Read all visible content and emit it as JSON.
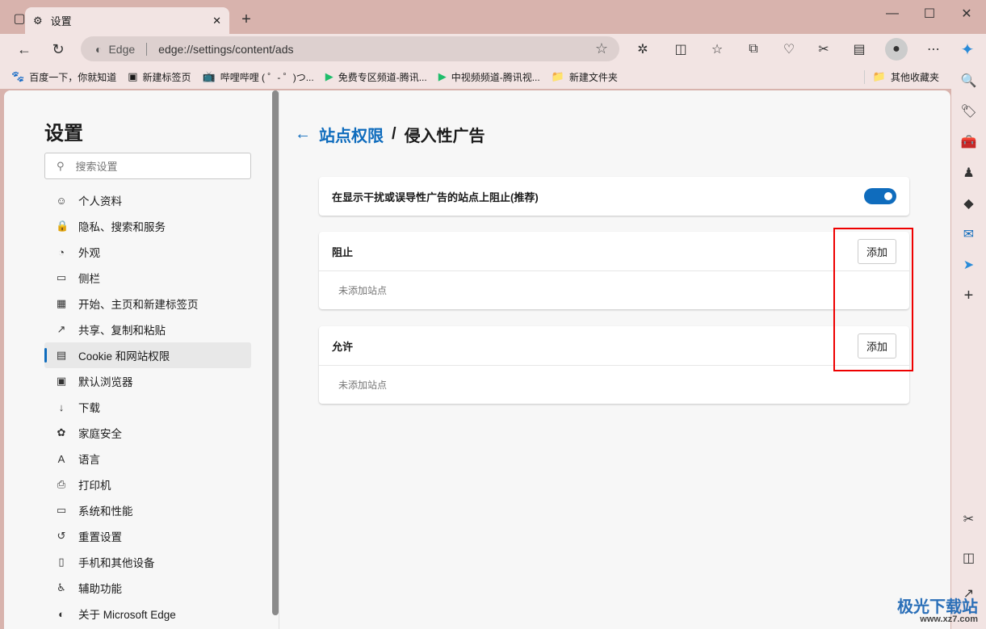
{
  "browser": {
    "tab_title": "设置",
    "address_label": "Edge",
    "url": "edge://settings/content/ads",
    "bookmarks": [
      {
        "label": "百度一下，你就知道",
        "icon": "paw-icon"
      },
      {
        "label": "新建标签页",
        "icon": "newtab-icon"
      },
      {
        "label": "哔哩哔哩 ( ゜- ゜)つ...",
        "icon": "bilibili-icon"
      },
      {
        "label": "免费专区频道-腾讯...",
        "icon": "tencent-video-icon"
      },
      {
        "label": "中视频频道-腾讯视...",
        "icon": "tencent-video-icon"
      },
      {
        "label": "新建文件夹",
        "icon": "folder-icon"
      }
    ],
    "other_bookmarks": "其他收藏夹"
  },
  "settings": {
    "title": "设置",
    "search_placeholder": "搜索设置",
    "nav": [
      {
        "label": "个人资料",
        "icon": "profile-icon"
      },
      {
        "label": "隐私、搜索和服务",
        "icon": "lock-icon"
      },
      {
        "label": "外观",
        "icon": "palette-icon"
      },
      {
        "label": "侧栏",
        "icon": "sidebar-icon"
      },
      {
        "label": "开始、主页和新建标签页",
        "icon": "home-icon"
      },
      {
        "label": "共享、复制和粘贴",
        "icon": "share-icon"
      },
      {
        "label": "Cookie 和网站权限",
        "icon": "cookie-icon",
        "active": true
      },
      {
        "label": "默认浏览器",
        "icon": "browser-icon"
      },
      {
        "label": "下载",
        "icon": "download-icon"
      },
      {
        "label": "家庭安全",
        "icon": "family-icon"
      },
      {
        "label": "语言",
        "icon": "language-icon"
      },
      {
        "label": "打印机",
        "icon": "printer-icon"
      },
      {
        "label": "系统和性能",
        "icon": "laptop-icon"
      },
      {
        "label": "重置设置",
        "icon": "reset-icon"
      },
      {
        "label": "手机和其他设备",
        "icon": "phone-icon"
      },
      {
        "label": "辅助功能",
        "icon": "accessibility-icon"
      },
      {
        "label": "关于 Microsoft Edge",
        "icon": "edge-icon"
      }
    ]
  },
  "page": {
    "breadcrumb_parent": "站点权限",
    "breadcrumb_sep": "/",
    "breadcrumb_current": "侵入性广告",
    "toggle_label": "在显示干扰或误导性广告的站点上阻止(推荐)",
    "toggle_on": true,
    "block": {
      "title": "阻止",
      "add": "添加",
      "empty": "未添加站点"
    },
    "allow": {
      "title": "允许",
      "add": "添加",
      "empty": "未添加站点"
    }
  },
  "colors": {
    "accent": "#0f6cbd",
    "highlight_box": "#ee0000"
  },
  "watermark": {
    "name": "极光下载站",
    "url": "www.xz7.com"
  }
}
